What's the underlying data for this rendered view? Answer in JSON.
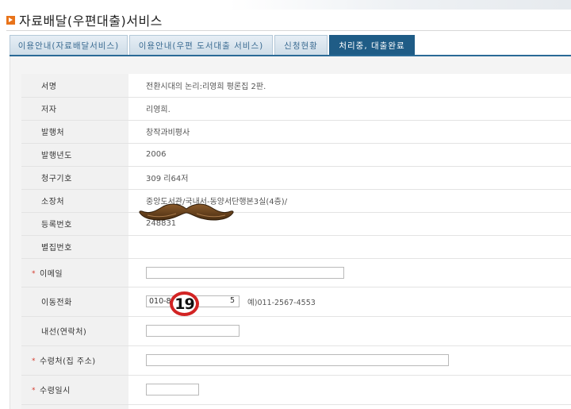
{
  "page": {
    "title": "자료배달(우편대출)서비스"
  },
  "tabs": [
    {
      "label": "이용안내(자료배달서비스)",
      "active": false
    },
    {
      "label": "이용안내(우편 도서대출 서비스)",
      "active": false
    },
    {
      "label": "신청현황",
      "active": false
    },
    {
      "label": "처리중, 대출완료",
      "active": true
    }
  ],
  "book_info": {
    "title_label": "서명",
    "title_value": "전환시대의 논리:리영희 평론집 2판.",
    "author_label": "저자",
    "author_value": "리영희.",
    "publisher_label": "발행처",
    "publisher_value": "창작과비평사",
    "year_label": "발행년도",
    "year_value": "2006",
    "call_number_label": "청구기호",
    "call_number_value": "309 리64저",
    "location_label": "소장처",
    "location_value": "중앙도서관/국내서-동양서단행본3실(4층)/",
    "registration_label": "등록번호",
    "registration_value": "248831",
    "volume_label": "별집번호",
    "volume_value": ""
  },
  "form": {
    "required_mark": "*",
    "email_label": "이메일",
    "email_value": "",
    "mobile_label": "이동전화",
    "mobile_value": "010-8",
    "mobile_value_tail": "5",
    "mobile_hint": "예)011-2567-4553",
    "extension_label": "내선(연락처)",
    "extension_value": "",
    "address_label": "수령처(집 주소)",
    "address_value": "",
    "date_label": "수령일시",
    "date_value": ""
  },
  "overlays": {
    "number_badge": "19",
    "mustache_icon": "mustache-icon"
  }
}
